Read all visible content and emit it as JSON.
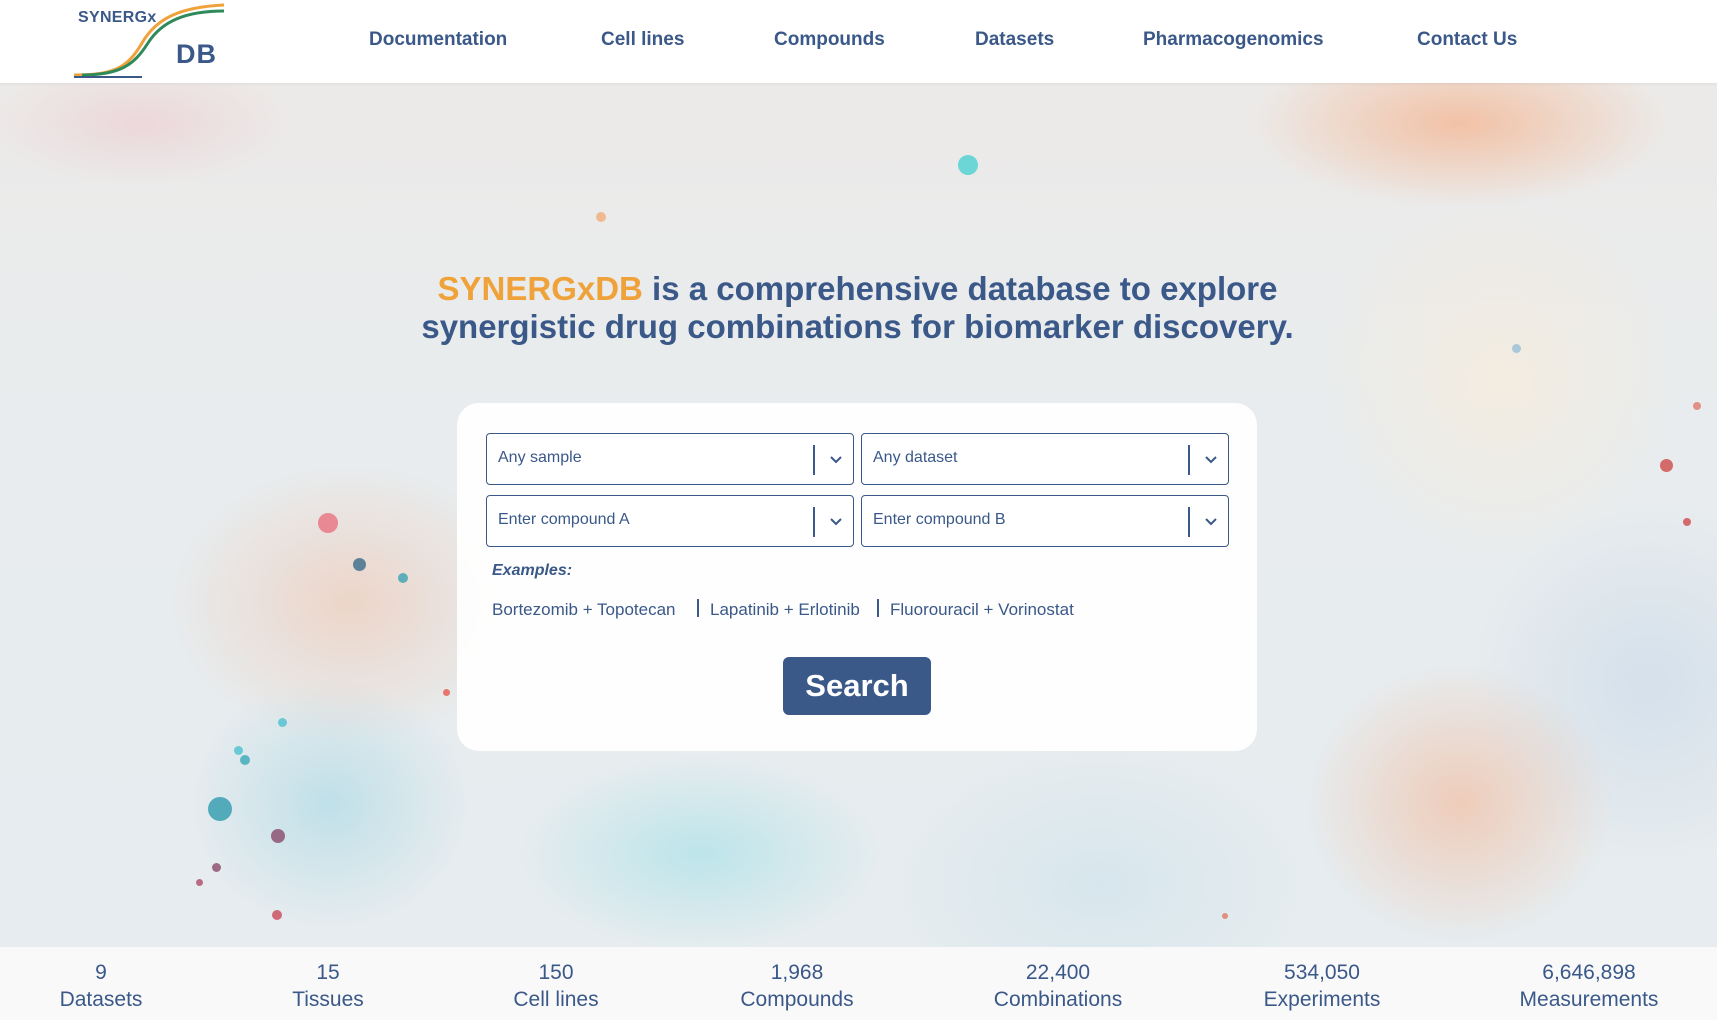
{
  "logo": {
    "line1": "SYNERGx",
    "line2": "DB"
  },
  "nav": [
    {
      "label": "Documentation"
    },
    {
      "label": "Cell lines"
    },
    {
      "label": "Compounds"
    },
    {
      "label": "Datasets"
    },
    {
      "label": "Pharmacogenomics"
    },
    {
      "label": "Contact Us"
    }
  ],
  "headline": {
    "brand": "SYNERGxDB",
    "line1_rest": " is a comprehensive database to explore",
    "line2": "synergistic drug combinations for biomarker discovery."
  },
  "search": {
    "sample_placeholder": "Any sample",
    "dataset_placeholder": "Any dataset",
    "compound_a_placeholder": "Enter compound A",
    "compound_b_placeholder": "Enter compound B",
    "examples_label": "Examples:",
    "examples": [
      "Bortezomib + Topotecan",
      "Lapatinib + Erlotinib",
      "Fluorouracil + Vorinostat"
    ],
    "button_label": "Search"
  },
  "stats": [
    {
      "value": "9",
      "label": "Datasets"
    },
    {
      "value": "15",
      "label": "Tissues"
    },
    {
      "value": "150",
      "label": "Cell lines"
    },
    {
      "value": "1,968",
      "label": "Compounds"
    },
    {
      "value": "22,400",
      "label": "Combinations"
    },
    {
      "value": "534,050",
      "label": "Experiments"
    },
    {
      "value": "6,646,898",
      "label": "Measurements"
    }
  ],
  "colors": {
    "primary": "#3a5888",
    "brand_accent": "#f0a23a",
    "logo_green": "#2f8a5a",
    "logo_orange": "#f0a23a"
  }
}
